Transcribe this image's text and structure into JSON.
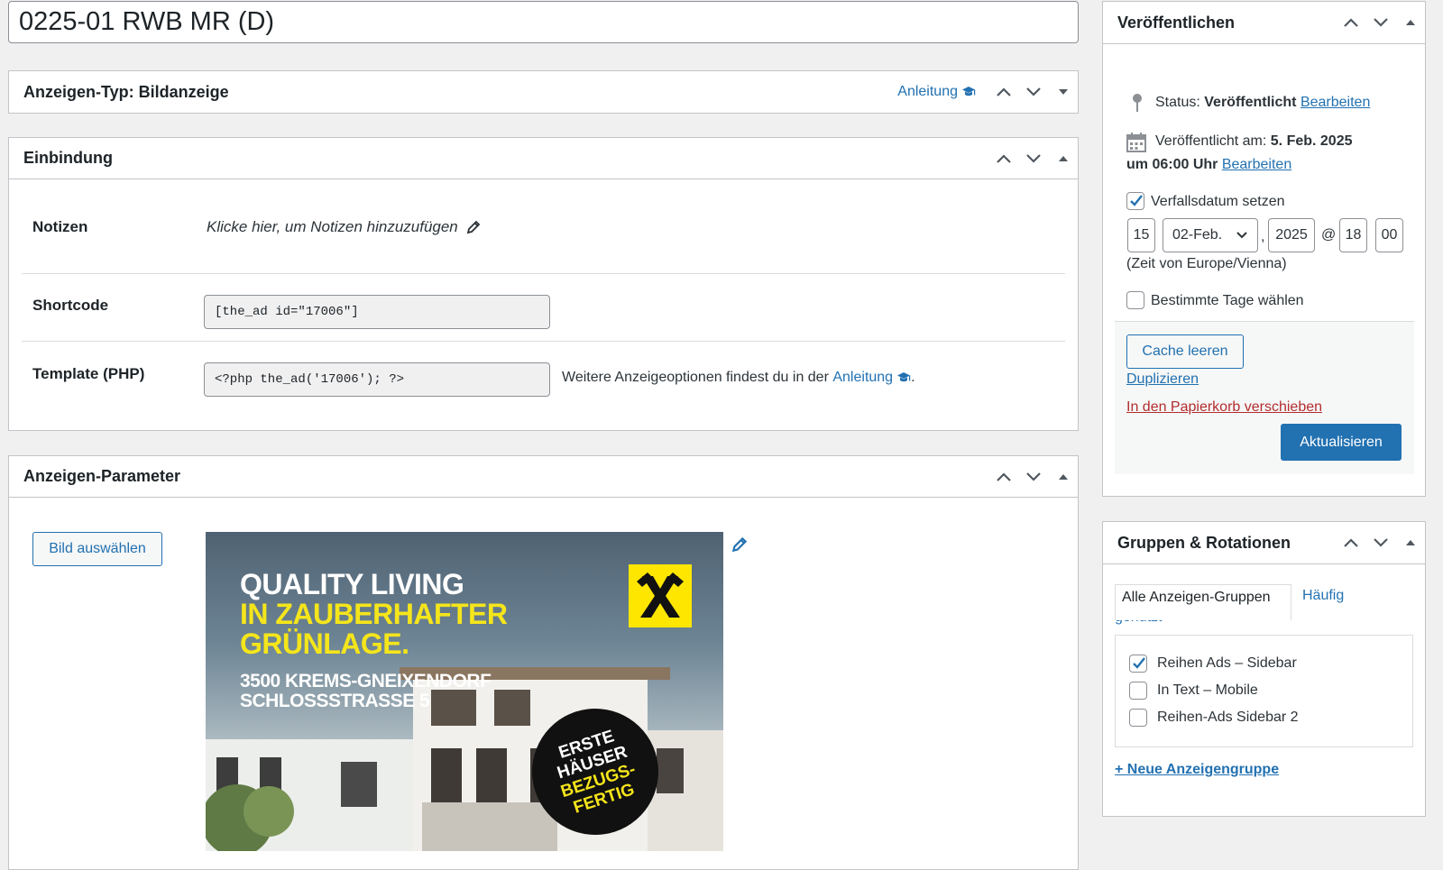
{
  "title": "0225-01 RWB MR (D)",
  "ad_type_box": {
    "title": "Anzeigen-Typ: Bildanzeige",
    "help_link": "Anleitung"
  },
  "embed_box": {
    "title": "Einbindung",
    "notes_label": "Notizen",
    "notes_placeholder": "Klicke hier, um Notizen hinzuzufügen",
    "shortcode_label": "Shortcode",
    "shortcode_value": "[the_ad id=\"17006\"]",
    "template_label": "Template (PHP)",
    "template_value": "<?php the_ad('17006'); ?>",
    "template_hint": "Weitere Anzeigeoptionen findest du in der",
    "template_hint_link": "Anleitung",
    "template_hint_end": "."
  },
  "params_box": {
    "title": "Anzeigen-Parameter",
    "select_image_button": "Bild auswählen",
    "ad": {
      "line1": "QUALITY LIVING",
      "line2": "IN ZAUBERHAFTER",
      "line3": "GRÜNLAGE.",
      "address1": "3500 KREMS-GNEIXENDORF",
      "address2": "SCHLOSSSTRASSE 5",
      "badge": [
        "ERSTE",
        "HÄUSER",
        "BEZUGS-",
        "FERTIG"
      ]
    }
  },
  "publish_box": {
    "title": "Veröffentlichen",
    "status_label": "Status:",
    "status_value": "Veröffentlicht",
    "edit_link": "Bearbeiten",
    "published_label": "Veröffentlicht am:",
    "published_date": "5. Feb. 2025",
    "published_time": "um 06:00 Uhr",
    "expiry_checkbox": "Verfallsdatum setzen",
    "expiry_day": "15",
    "expiry_month": "02-Feb.",
    "expiry_year": "2025",
    "at_sign": "@",
    "expiry_hour": "18",
    "expiry_minute": "00",
    "timezone": "(Zeit von Europe/Vienna)",
    "specific_days": "Bestimmte Tage wählen",
    "cache_button": "Cache leeren",
    "duplicate_link": "Duplizieren",
    "trash_link": "In den Papierkorb verschieben",
    "update_button": "Aktualisieren"
  },
  "groups_box": {
    "title": "Gruppen & Rotationen",
    "tab_all": "Alle Anzeigen-Gruppen",
    "tab_frequent_1": "Häufig",
    "tab_frequent_2": "genutzt",
    "groups": [
      {
        "label": "Reihen Ads – Sidebar",
        "checked": true
      },
      {
        "label": "In Text – Mobile",
        "checked": false
      },
      {
        "label": "Reihen-Ads Sidebar 2",
        "checked": false
      }
    ],
    "new_group_link": "+ Neue Anzeigengruppe"
  },
  "colors": {
    "accent": "#2271b1",
    "danger": "#b32d2e",
    "logo_yellow": "#ffe600",
    "ad_highlight": "#f5e51b"
  }
}
